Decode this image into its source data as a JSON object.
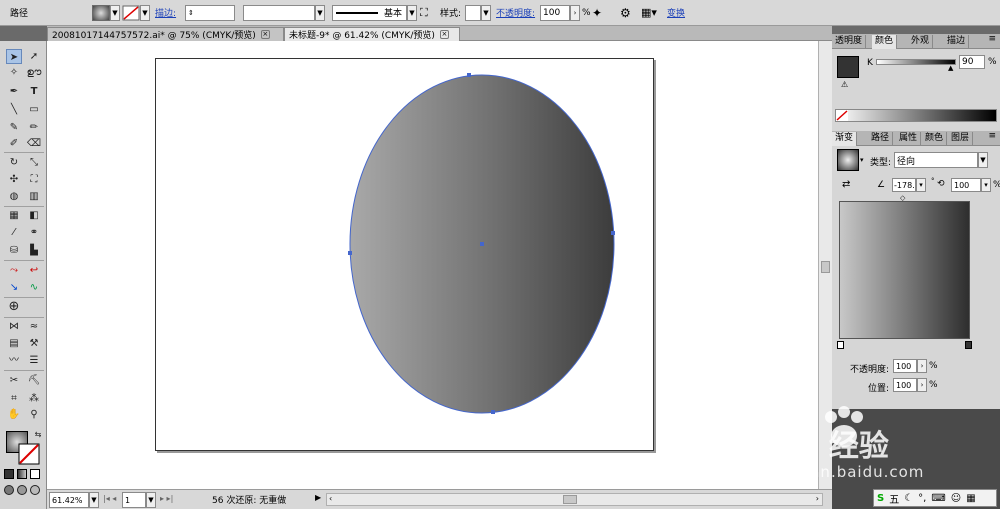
{
  "control": {
    "label": "路径",
    "stroke_link": "描边:",
    "stroke_preset": "基本",
    "style_label": "样式:",
    "opacity_link": "不透明度:",
    "opacity_value": "100",
    "opacity_unit": "%",
    "transform_link": "变换"
  },
  "tabs": [
    {
      "label": "20081017144757572.ai* @ 75% (CMYK/预览)"
    },
    {
      "label": "未标题-9* @ 61.42% (CMYK/预览)"
    }
  ],
  "color_panel": {
    "tabs": [
      "透明度",
      "颜色",
      "外观",
      "描边"
    ],
    "channel": "K",
    "value": "90",
    "unit": "%"
  },
  "gradient_panel": {
    "tabs": [
      "渐变",
      "路径",
      "属性",
      "颜色",
      "图层"
    ],
    "type_label": "类型:",
    "type_value": "径向",
    "angle": "-178.",
    "aspect": "100",
    "aspect_unit": "%",
    "opacity_label": "不透明度:",
    "opacity_value": "100",
    "opacity_unit": "%",
    "location_label": "位置:",
    "location_value": "100",
    "location_unit": "%"
  },
  "status": {
    "zoom": "61.42%",
    "page": "1",
    "undo_text": "56 次还原: 无重做"
  },
  "watermark": {
    "brand": "Bai 经验",
    "url": "jingyan.baidu.com"
  },
  "dock": {
    "ime": "五"
  },
  "colors": {
    "accent": "#4466cc",
    "gradient_light": "#aaaaaa",
    "gradient_dark": "#3a3a3a"
  }
}
